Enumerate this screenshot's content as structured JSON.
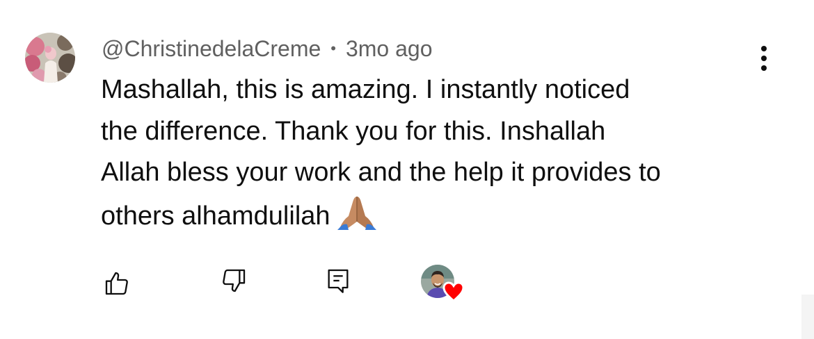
{
  "comment": {
    "author_handle": "@ChristinedelaCreme",
    "separator": "•",
    "timestamp": "3mo ago",
    "lines": [
      "Mashallah, this is amazing. I instantly noticed",
      "the difference. Thank you for this. Inshallah",
      "Allah bless your work and the help it provides to",
      "others alhamdulilah"
    ],
    "emoji": "folded-hands-medium-skin-tone"
  },
  "actions": {
    "like_icon": "thumbs-up-icon",
    "dislike_icon": "thumbs-down-icon",
    "reply_icon": "reply-comment-icon",
    "creator_heart_icon": "heart-icon",
    "menu_icon": "more-vertical-icon"
  },
  "colors": {
    "text": "#0f0f0f",
    "meta_text": "#606060",
    "heart": "#ff0000",
    "skin": "#c68b62"
  }
}
